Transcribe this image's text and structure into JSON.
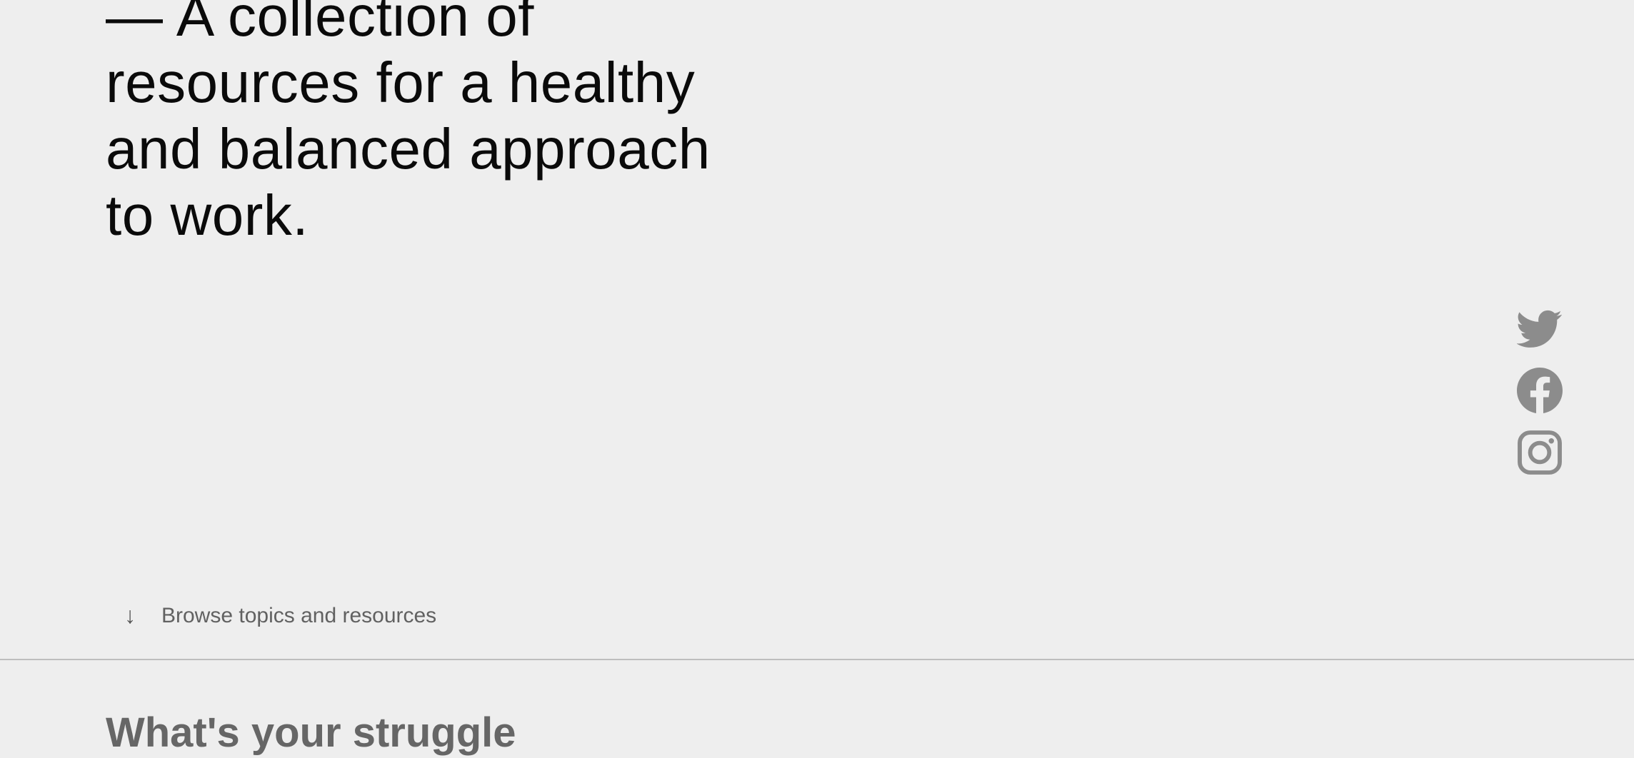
{
  "hero": {
    "lines": [
      "— A collection of",
      "resources for a healthy",
      "and balanced approach",
      "to work."
    ]
  },
  "social": {
    "icon_color": "#8c8c8c",
    "items": [
      {
        "icon": "twitter-icon"
      },
      {
        "icon": "facebook-icon"
      },
      {
        "icon": "instagram-icon"
      }
    ]
  },
  "browse": {
    "arrow": "↓",
    "label": "Browse topics and resources"
  },
  "section": {
    "heading": "What's your struggle"
  }
}
